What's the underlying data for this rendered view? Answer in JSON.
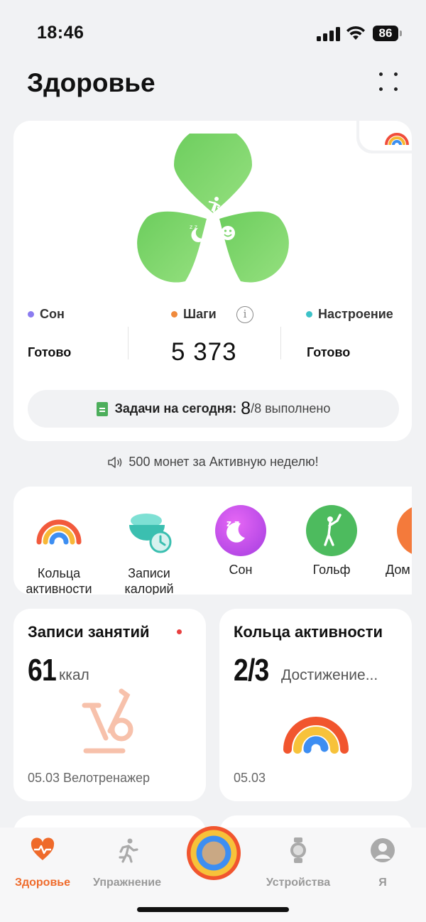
{
  "status": {
    "time": "18:46",
    "battery": "86"
  },
  "header": {
    "title": "Здоровье"
  },
  "hero": {
    "stats": [
      {
        "label": "Сон",
        "value": "Готово",
        "dot": "#8b7cf0"
      },
      {
        "label": "Шаги",
        "value": "5 373",
        "dot": "#f08a3c"
      },
      {
        "label": "Настроение",
        "value": "Готово",
        "dot": "#3cc2c8"
      }
    ],
    "tasks": {
      "label": "Задачи на сегодня:",
      "done": "8",
      "total": "/8 выполнено"
    }
  },
  "promo": "500 монет за Активную неделю!",
  "shortcuts": [
    {
      "label": "Кольца активности",
      "icon": "activity-rings-icon"
    },
    {
      "label": "Записи калорий",
      "icon": "food-bowl-icon"
    },
    {
      "label": "Сон",
      "icon": "sleep-moon-icon"
    },
    {
      "label": "Гольф",
      "icon": "golf-icon"
    },
    {
      "label": "Дом трен",
      "icon": "home-workout-icon"
    }
  ],
  "cards": {
    "workouts": {
      "title": "Записи занятий",
      "value": "61",
      "unit": "ккал",
      "footer": "05.03 Велотренажер"
    },
    "rings": {
      "title": "Кольца активности",
      "value": "2/3",
      "unit": "Достижение...",
      "footer": "05.03"
    }
  },
  "tabs": [
    {
      "label": "Здоровье",
      "icon": "heart-pulse-icon",
      "active": true
    },
    {
      "label": "Упражнение",
      "icon": "runner-icon",
      "active": false
    },
    {
      "label": "Устройства",
      "icon": "watch-icon",
      "active": false
    },
    {
      "label": "Я",
      "icon": "user-icon",
      "active": false
    }
  ],
  "colors": {
    "accent": "#ef6a2a",
    "leaf": "#7dd66e",
    "background": "#f1f2f4"
  }
}
